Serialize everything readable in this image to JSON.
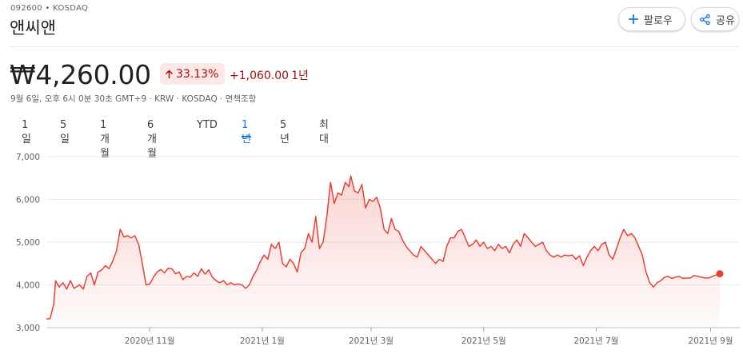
{
  "header": {
    "ticker_line": "092600 • KOSDAQ",
    "company_name": "앤씨앤",
    "follow_label": "팔로우",
    "share_label": "공유"
  },
  "quote": {
    "price": "₩4,260.00",
    "change_percent": "33.13%",
    "change_amount": "+1,060.00",
    "change_period": "1년",
    "meta": "9월 6일, 오후 6시 0분 30초 GMT+9 · KRW · KOSDAQ · 면책조항"
  },
  "range_tabs": [
    {
      "label": "1일"
    },
    {
      "label": "5일"
    },
    {
      "label": "1개월"
    },
    {
      "label": "6개월"
    },
    {
      "label": "YTD"
    },
    {
      "label": "1년"
    },
    {
      "label": "5년"
    },
    {
      "label": "최대"
    }
  ],
  "active_tab": "1년",
  "colors": {
    "accent": "#1a73e8",
    "negative_red": "#a50e0e",
    "chart_line": "#e94235"
  },
  "chart_data": {
    "type": "area",
    "title": "",
    "xlabel": "",
    "ylabel": "",
    "ylim": [
      3000,
      7000
    ],
    "yticks": [
      3000,
      4000,
      5000,
      6000,
      7000
    ],
    "ytick_labels": [
      "3,000",
      "4,000",
      "5,000",
      "6,000",
      "7,000"
    ],
    "xtick_labels": [
      "2020년 11월",
      "2021년 1월",
      "2021년 3월",
      "2021년 5월",
      "2021년 7월",
      "2021년 9월"
    ],
    "xtick_dates": [
      "2020-11-01",
      "2021-01-01",
      "2021-03-01",
      "2021-05-01",
      "2021-07-01",
      "2021-09-01"
    ],
    "x_range": [
      "2020-09-06",
      "2021-09-06"
    ],
    "grid": true,
    "series": [
      {
        "values": [
          [
            "2020-09-06",
            3200
          ],
          [
            "2020-09-08",
            3210
          ],
          [
            "2020-09-10",
            3550
          ],
          [
            "2020-09-11",
            4100
          ],
          [
            "2020-09-13",
            3950
          ],
          [
            "2020-09-15",
            4050
          ],
          [
            "2020-09-17",
            3900
          ],
          [
            "2020-09-19",
            4100
          ],
          [
            "2020-09-21",
            3920
          ],
          [
            "2020-09-24",
            4000
          ],
          [
            "2020-09-26",
            3900
          ],
          [
            "2020-09-28",
            4200
          ],
          [
            "2020-09-30",
            4280
          ],
          [
            "2020-10-02",
            4000
          ],
          [
            "2020-10-04",
            4300
          ],
          [
            "2020-10-06",
            4350
          ],
          [
            "2020-10-08",
            4450
          ],
          [
            "2020-10-10",
            4380
          ],
          [
            "2020-10-12",
            4560
          ],
          [
            "2020-10-14",
            4800
          ],
          [
            "2020-10-16",
            5300
          ],
          [
            "2020-10-18",
            5120
          ],
          [
            "2020-10-20",
            5150
          ],
          [
            "2020-10-22",
            5100
          ],
          [
            "2020-10-24",
            5150
          ],
          [
            "2020-10-26",
            4950
          ],
          [
            "2020-10-28",
            4500
          ],
          [
            "2020-10-30",
            4000
          ],
          [
            "2020-11-01",
            4020
          ],
          [
            "2020-11-03",
            4180
          ],
          [
            "2020-11-05",
            4300
          ],
          [
            "2020-11-07",
            4360
          ],
          [
            "2020-11-09",
            4280
          ],
          [
            "2020-11-11",
            4390
          ],
          [
            "2020-11-13",
            4380
          ],
          [
            "2020-11-15",
            4260
          ],
          [
            "2020-11-17",
            4300
          ],
          [
            "2020-11-19",
            4120
          ],
          [
            "2020-11-21",
            4200
          ],
          [
            "2020-11-23",
            4180
          ],
          [
            "2020-11-25",
            4280
          ],
          [
            "2020-11-27",
            4200
          ],
          [
            "2020-11-29",
            4380
          ],
          [
            "2020-12-01",
            4250
          ],
          [
            "2020-12-03",
            4350
          ],
          [
            "2020-12-05",
            4180
          ],
          [
            "2020-12-07",
            4100
          ],
          [
            "2020-12-09",
            4050
          ],
          [
            "2020-12-11",
            4100
          ],
          [
            "2020-12-13",
            4000
          ],
          [
            "2020-12-15",
            4050
          ],
          [
            "2020-12-17",
            4000
          ],
          [
            "2020-12-19",
            4020
          ],
          [
            "2020-12-21",
            4000
          ],
          [
            "2020-12-23",
            3920
          ],
          [
            "2020-12-25",
            4000
          ],
          [
            "2020-12-27",
            4200
          ],
          [
            "2020-12-29",
            4350
          ],
          [
            "2020-12-31",
            4550
          ],
          [
            "2021-01-02",
            4700
          ],
          [
            "2021-01-04",
            4600
          ],
          [
            "2021-01-06",
            4950
          ],
          [
            "2021-01-08",
            4850
          ],
          [
            "2021-01-10",
            5000
          ],
          [
            "2021-01-12",
            4500
          ],
          [
            "2021-01-14",
            4420
          ],
          [
            "2021-01-16",
            4600
          ],
          [
            "2021-01-18",
            4500
          ],
          [
            "2021-01-20",
            4300
          ],
          [
            "2021-01-22",
            4750
          ],
          [
            "2021-01-24",
            4850
          ],
          [
            "2021-01-26",
            5200
          ],
          [
            "2021-01-28",
            5000
          ],
          [
            "2021-01-30",
            5600
          ],
          [
            "2021-02-01",
            4850
          ],
          [
            "2021-02-03",
            5000
          ],
          [
            "2021-02-05",
            5600
          ],
          [
            "2021-02-07",
            6400
          ],
          [
            "2021-02-09",
            5900
          ],
          [
            "2021-02-11",
            6150
          ],
          [
            "2021-02-13",
            6100
          ],
          [
            "2021-02-15",
            6400
          ],
          [
            "2021-02-17",
            6300
          ],
          [
            "2021-02-18",
            6550
          ],
          [
            "2021-02-20",
            6200
          ],
          [
            "2021-02-22",
            6150
          ],
          [
            "2021-02-24",
            6350
          ],
          [
            "2021-02-26",
            5800
          ],
          [
            "2021-02-28",
            6000
          ],
          [
            "2021-03-02",
            5950
          ],
          [
            "2021-03-04",
            6050
          ],
          [
            "2021-03-06",
            5800
          ],
          [
            "2021-03-08",
            5300
          ],
          [
            "2021-03-10",
            5200
          ],
          [
            "2021-03-12",
            5550
          ],
          [
            "2021-03-14",
            5300
          ],
          [
            "2021-03-16",
            5250
          ],
          [
            "2021-03-18",
            5050
          ],
          [
            "2021-03-20",
            4900
          ],
          [
            "2021-03-22",
            4800
          ],
          [
            "2021-03-24",
            4700
          ],
          [
            "2021-03-26",
            4650
          ],
          [
            "2021-03-28",
            4900
          ],
          [
            "2021-03-30",
            4800
          ],
          [
            "2021-04-01",
            4700
          ],
          [
            "2021-04-03",
            4600
          ],
          [
            "2021-04-05",
            4500
          ],
          [
            "2021-04-07",
            4600
          ],
          [
            "2021-04-09",
            4550
          ],
          [
            "2021-04-11",
            4900
          ],
          [
            "2021-04-13",
            5100
          ],
          [
            "2021-04-15",
            5100
          ],
          [
            "2021-04-17",
            5250
          ],
          [
            "2021-04-19",
            5300
          ],
          [
            "2021-04-21",
            5100
          ],
          [
            "2021-04-23",
            4900
          ],
          [
            "2021-04-25",
            4950
          ],
          [
            "2021-04-27",
            5050
          ],
          [
            "2021-04-29",
            4900
          ],
          [
            "2021-05-01",
            5000
          ],
          [
            "2021-05-03",
            4850
          ],
          [
            "2021-05-05",
            4900
          ],
          [
            "2021-05-07",
            4800
          ],
          [
            "2021-05-09",
            4950
          ],
          [
            "2021-05-11",
            4850
          ],
          [
            "2021-05-13",
            4900
          ],
          [
            "2021-05-15",
            4750
          ],
          [
            "2021-05-17",
            4950
          ],
          [
            "2021-05-19",
            5050
          ],
          [
            "2021-05-21",
            4900
          ],
          [
            "2021-05-23",
            5200
          ],
          [
            "2021-05-25",
            5100
          ],
          [
            "2021-05-27",
            5000
          ],
          [
            "2021-05-29",
            4900
          ],
          [
            "2021-05-31",
            4950
          ],
          [
            "2021-06-02",
            5000
          ],
          [
            "2021-06-04",
            4800
          ],
          [
            "2021-06-06",
            4700
          ],
          [
            "2021-06-08",
            4650
          ],
          [
            "2021-06-10",
            4700
          ],
          [
            "2021-06-12",
            4650
          ],
          [
            "2021-06-14",
            4700
          ],
          [
            "2021-06-16",
            4680
          ],
          [
            "2021-06-18",
            4700
          ],
          [
            "2021-06-20",
            4600
          ],
          [
            "2021-06-22",
            4680
          ],
          [
            "2021-06-24",
            4450
          ],
          [
            "2021-06-26",
            4650
          ],
          [
            "2021-06-28",
            4800
          ],
          [
            "2021-06-30",
            4900
          ],
          [
            "2021-07-02",
            4800
          ],
          [
            "2021-07-04",
            4950
          ],
          [
            "2021-07-06",
            5000
          ],
          [
            "2021-07-08",
            4700
          ],
          [
            "2021-07-10",
            4600
          ],
          [
            "2021-07-12",
            4850
          ],
          [
            "2021-07-14",
            5100
          ],
          [
            "2021-07-16",
            5300
          ],
          [
            "2021-07-18",
            5150
          ],
          [
            "2021-07-20",
            5200
          ],
          [
            "2021-07-22",
            5100
          ],
          [
            "2021-07-24",
            4900
          ],
          [
            "2021-07-26",
            4700
          ],
          [
            "2021-07-28",
            4300
          ],
          [
            "2021-07-30",
            4050
          ],
          [
            "2021-08-01",
            3950
          ],
          [
            "2021-08-03",
            4050
          ],
          [
            "2021-08-05",
            4100
          ],
          [
            "2021-08-07",
            4180
          ],
          [
            "2021-08-09",
            4200
          ],
          [
            "2021-08-11",
            4150
          ],
          [
            "2021-08-13",
            4180
          ],
          [
            "2021-08-15",
            4200
          ],
          [
            "2021-08-17",
            4150
          ],
          [
            "2021-08-19",
            4160
          ],
          [
            "2021-08-21",
            4160
          ],
          [
            "2021-08-23",
            4220
          ],
          [
            "2021-08-25",
            4200
          ],
          [
            "2021-08-27",
            4180
          ],
          [
            "2021-08-29",
            4160
          ],
          [
            "2021-08-31",
            4160
          ],
          [
            "2021-09-02",
            4200
          ],
          [
            "2021-09-04",
            4230
          ],
          [
            "2021-09-06",
            4260
          ]
        ]
      }
    ]
  }
}
